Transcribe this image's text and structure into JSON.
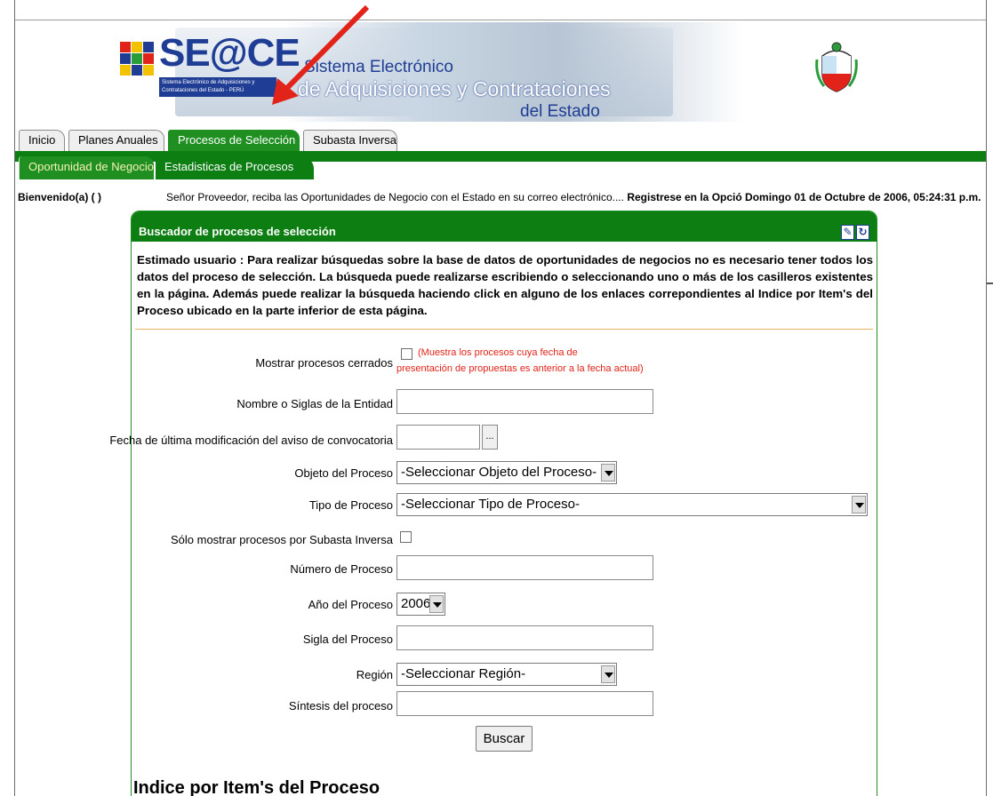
{
  "banner": {
    "logo_text": "SE@CE",
    "logo_sub": "Sistema Electrónico de Adquisiciones y Contrataciones del Estado - PERÚ",
    "system_line1": "Sistema Electrónico",
    "system_line2": "de Adquisiciones y Contrataciones",
    "system_line3": "del Estado"
  },
  "colors": {
    "nav_green": "#0d7e12",
    "tab_active": "#1f8f22",
    "brand_blue": "#1f3d94",
    "annotation_red": "#e2231a"
  },
  "tabs": [
    {
      "label": "Inicio",
      "active": false
    },
    {
      "label": "Planes Anuales",
      "active": false
    },
    {
      "label": "Procesos de Selección",
      "active": true
    },
    {
      "label": "Subasta Inversa",
      "active": false
    }
  ],
  "subtabs": [
    {
      "label": "Oportunidad de Negocio",
      "active": true
    },
    {
      "label": "Estadisticas de Procesos",
      "active": false
    }
  ],
  "welcome": "Bienvenido(a) ( )",
  "marquee": {
    "text": "Señor Proveedor, reciba las Oportunidades de Negocio con el Estado en su correo electrónico....",
    "bold_text": "Registrese en la Opció Domingo 01 de Octubre de 2006, 05:24:31 p.m."
  },
  "panel": {
    "title": "Buscador de procesos de selección",
    "icons": [
      "edit-icon",
      "refresh-icon"
    ],
    "intro": "Estimado usuario : Para realizar búsquedas sobre la base de datos de oportunidades de negocios no es necesario tener todos los datos del proceso de selección. La búsqueda puede realizarse escribiendo o seleccionando uno o más de los casilleros existentes en la página. Además puede realizar la búsqueda haciendo click en alguno de los enlaces correpondientes al Indice por Item's del Proceso ubicado en la parte inferior de esta página."
  },
  "form": {
    "mostrar_cerrados": {
      "label": "Mostrar procesos cerrados",
      "checked": false,
      "note_line1": "(Muestra los procesos cuya fecha de",
      "note_line2": "presentación de propuestas es anterior a la fecha actual)"
    },
    "nombre_entidad": {
      "label": "Nombre o Siglas de la Entidad",
      "value": ""
    },
    "fecha_modificacion": {
      "label": "Fecha de última modificación del aviso de convocatoria",
      "value": "",
      "button": "..."
    },
    "objeto_proceso": {
      "label": "Objeto del Proceso",
      "selected": "-Seleccionar Objeto del Proceso-"
    },
    "tipo_proceso": {
      "label": "Tipo de Proceso",
      "selected": "-Seleccionar Tipo de Proceso-"
    },
    "subasta_inversa": {
      "label": "Sólo mostrar procesos por Subasta Inversa",
      "checked": false
    },
    "numero_proceso": {
      "label": "Número de Proceso",
      "value": ""
    },
    "anio_proceso": {
      "label": "Año del Proceso",
      "selected": "2006"
    },
    "sigla_proceso": {
      "label": "Sigla del Proceso",
      "value": ""
    },
    "region": {
      "label": "Región",
      "selected": "-Seleccionar Región-"
    },
    "sintesis": {
      "label": "Síntesis del proceso",
      "value": ""
    },
    "buscar_label": "Buscar"
  },
  "indice_heading": "Indice por Item's del Proceso"
}
